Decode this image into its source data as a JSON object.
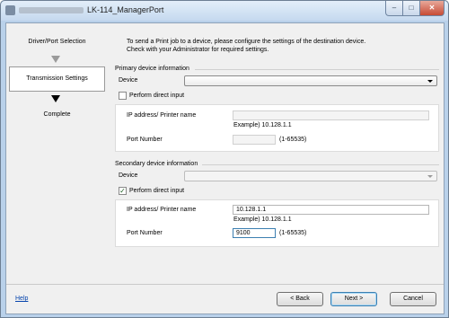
{
  "window": {
    "title": "LK-114_ManagerPort",
    "buttons": {
      "minimize": "–",
      "maximize": "□",
      "close": "✕"
    }
  },
  "steps": [
    {
      "label": "Driver/Port Selection",
      "state": "done"
    },
    {
      "label": "Transmission Settings",
      "state": "current"
    },
    {
      "label": "Complete",
      "state": "pending"
    }
  ],
  "intro": {
    "line1": "To send a Print job to a device, please configure the settings of the destination device.",
    "line2": "Check with your Administrator for required settings."
  },
  "primary": {
    "group_label": "Primary device information",
    "device_label": "Device",
    "device_value": "",
    "direct_input_label": "Perform direct input",
    "direct_input_checked": false,
    "ip_label": "IP address/ Printer name",
    "ip_value": "",
    "ip_example": "Example) 10.128.1.1",
    "port_label": "Port Number",
    "port_value": "",
    "port_range": "(1-65535)"
  },
  "secondary": {
    "group_label": "Secondary device information",
    "device_label": "Device",
    "device_value": "",
    "direct_input_label": "Perform direct input",
    "direct_input_checked": true,
    "check_mark": "✓",
    "ip_label": "IP address/ Printer name",
    "ip_value": "10.128.1.1",
    "ip_example": "Example) 10.128.1.1",
    "port_label": "Port Number",
    "port_value": "9100",
    "port_range": "(1-65535)"
  },
  "footer": {
    "help_label": "Help",
    "back_label": "< Back",
    "next_label": "Next >",
    "cancel_label": "Cancel"
  },
  "colors": {
    "frame": "#b9d1ea",
    "client_bg": "#f0f0f0",
    "link": "#0645ad",
    "default_button_border": "#3c7fb1"
  }
}
